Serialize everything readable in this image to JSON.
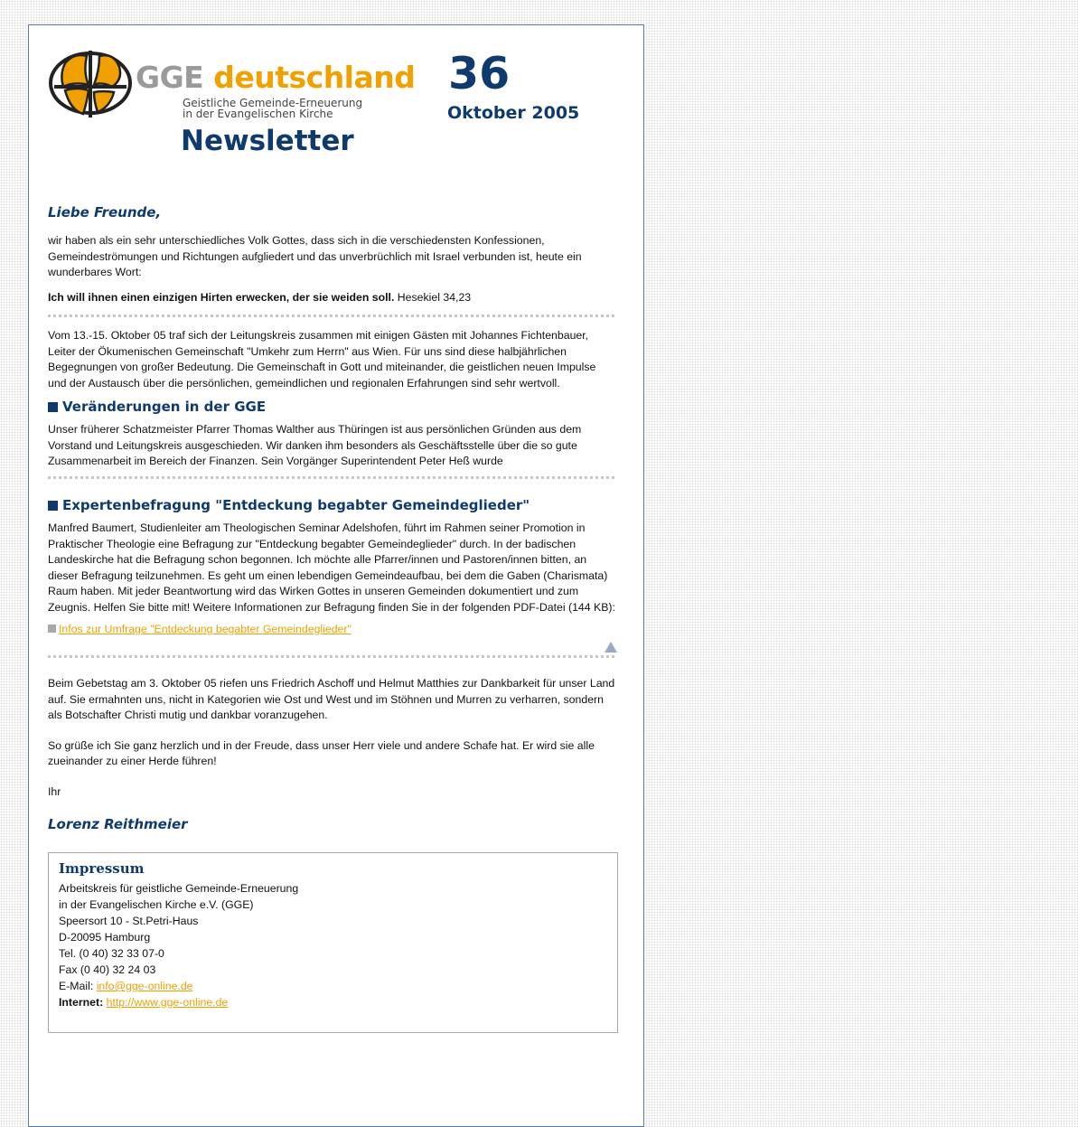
{
  "header": {
    "brand_gge": "GGE",
    "brand_name": "deutschland",
    "subtitle_line1": "Geistliche Gemeinde-Erneuerung",
    "subtitle_line2": "in der Evangelischen Kirche",
    "newsletter": "Newsletter",
    "issue_number": "36",
    "issue_date": "Oktober 2005",
    "colors": {
      "navy": "#0f3a6e",
      "orange": "#f0a000",
      "gray": "#9a9a9a"
    }
  },
  "greeting": "Liebe Freunde,",
  "intro": "wir haben als ein sehr unterschiedliches Volk Gottes, dass sich in die verschiedensten Konfessionen, Gemeindeströmungen und Richtungen aufgliedert und das unverbrüchlich mit Israel verbunden ist, heute ein wunderbares Wort:",
  "verse_bold": "Ich will ihnen einen einzigen Hirten erwecken, der sie weiden soll.",
  "verse_ref": " Hesekiel 34,23",
  "meeting": "Vom 13.-15. Oktober 05 traf sich der Leitungskreis zusammen mit einigen Gästen mit Johannes Fichtenbauer, Leiter der Ökumenischen Gemeinschaft \"Umkehr zum Herrn\" aus Wien. Für uns sind diese halbjährlichen Begegnungen von großer Bedeutung. Die Gemeinschaft in Gott und miteinander, die geistlichen neuen Impulse und der Austausch über die persönlichen, gemeindlichen und regionalen Erfahrungen sind sehr wertvoll.",
  "section1": {
    "title": "Veränderungen in der GGE",
    "text": "Unser früherer Schatzmeister Pfarrer Thomas Walther aus Thüringen ist aus persönlichen Gründen aus dem Vorstand und Leitungskreis ausgeschieden. Wir danken ihm besonders als Geschäftsstelle über die so gute Zusammenarbeit im Bereich der Finanzen. Sein Vorgänger Superintendent Peter Heß wurde"
  },
  "section2": {
    "title": "Expertenbefragung \"Entdeckung begabter Gemeindeglieder\"",
    "text": "Manfred Baumert, Studienleiter am Theologischen Seminar Adelshofen, führt im Rahmen seiner Promotion in Praktischer Theologie eine Befragung zur \"Entdeckung begabter Gemeindeglieder\" durch. In der badischen Landeskirche hat die Befragung schon begonnen. Ich möchte alle Pfarrer/innen und Pastoren/innen bitten, an dieser Befragung teilzunehmen. Es geht um einen lebendigen Gemeindeaufbau, bei dem die Gaben (Charismata) Raum haben. Mit jeder Beantwortung wird das Wirken Gottes in unseren Gemeinden dokumentiert und zum Zeugnis. Helfen Sie bitte mit! Weitere Informationen zur Befragung finden Sie in der folgenden PDF-Datei (144 KB):",
    "link": "Infos zur Umfrage \"Entdeckung begabter Gemeindeglieder\""
  },
  "gebetstag": "Beim Gebetstag am 3. Oktober 05 riefen uns Friedrich Aschoff und Helmut Matthies zur Dankbarkeit für unser Land auf. Sie ermahnten uns, nicht in Kategorien wie Ost und West und im Stöhnen und Murren zu verharren, sondern als Botschafter Christi mutig und dankbar voranzugehen.",
  "closing": "So grüße ich Sie ganz herzlich und in der Freude, dass unser Herr viele und andere Schafe hat. Er wird sie alle zueinander zu einer Herde führen!",
  "ihr": "Ihr",
  "signature": "Lorenz Reithmeier",
  "impressum": {
    "title": "Impressum",
    "line1": "Arbeitskreis für geistliche Gemeinde-Erneuerung",
    "line2": "in der Evangelischen Kirche e.V. (GGE)",
    "line3": "Speersort 10 - St.Petri-Haus",
    "line4": "D-20095 Hamburg",
    "line5": "Tel. (0 40) 32 33 07-0",
    "line6": "Fax (0 40) 32 24 03",
    "email_label": "E-Mail: ",
    "email": "info@gge-online.de",
    "internet_label": "Internet: ",
    "internet": "http://www.gge-online.de"
  }
}
